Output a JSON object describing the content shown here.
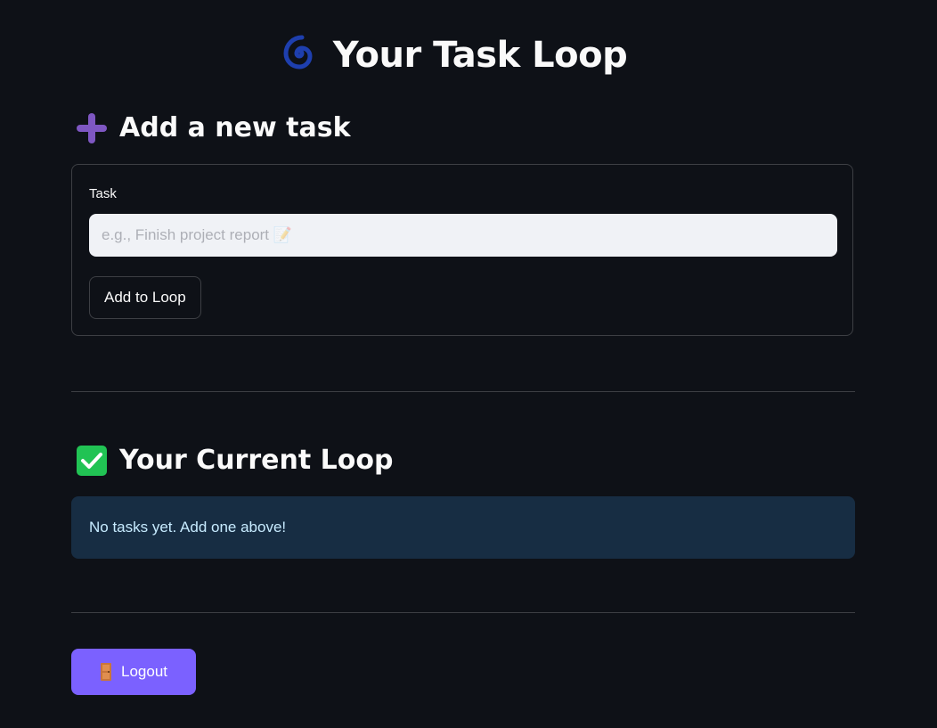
{
  "header": {
    "title": "Your Task Loop",
    "title_icon": "cyclone-icon"
  },
  "add_section": {
    "heading": "Add a new task",
    "heading_icon": "plus-icon",
    "field_label": "Task",
    "input_value": "",
    "input_placeholder": "e.g., Finish project report 📝",
    "submit_label": "Add to Loop"
  },
  "current_section": {
    "heading": "Your Current Loop",
    "heading_icon": "check-mark-icon",
    "empty_message": "No tasks yet. Add one above!"
  },
  "logout": {
    "label": "Logout",
    "icon": "door-icon"
  },
  "colors": {
    "background": "#0e1117",
    "accent": "#7b61ff",
    "info_bg": "#172d43",
    "info_text": "#c7ebff",
    "check_green": "#21c354",
    "plus_purple": "#7e57c2",
    "spiral_blue": "#1e3fae"
  }
}
